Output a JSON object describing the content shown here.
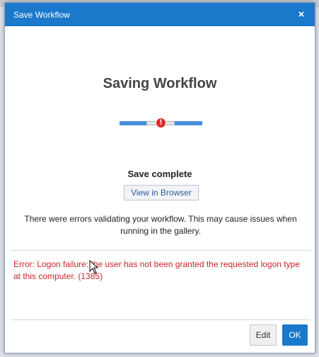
{
  "dialog": {
    "title": "Save Workflow",
    "close_label": "×",
    "heading": "Saving Workflow",
    "progress_error_glyph": "!",
    "status": "Save complete",
    "view_button": "View in Browser",
    "warning": "There were errors validating your workflow. This may cause issues when running in the gallery.",
    "error": "Error: Logon failure: the user has not been granted the requested logon type at this computer. (1385)",
    "edit_button": "Edit",
    "ok_button": "OK"
  },
  "colors": {
    "titlebar": "#1a79cb",
    "progress": "#4a90d9",
    "error_text": "#c9262a",
    "error_dot": "#e32a2a"
  },
  "icons": {
    "close": "close-icon",
    "error_indicator": "error-icon",
    "cursor": "mouse-pointer-icon"
  }
}
